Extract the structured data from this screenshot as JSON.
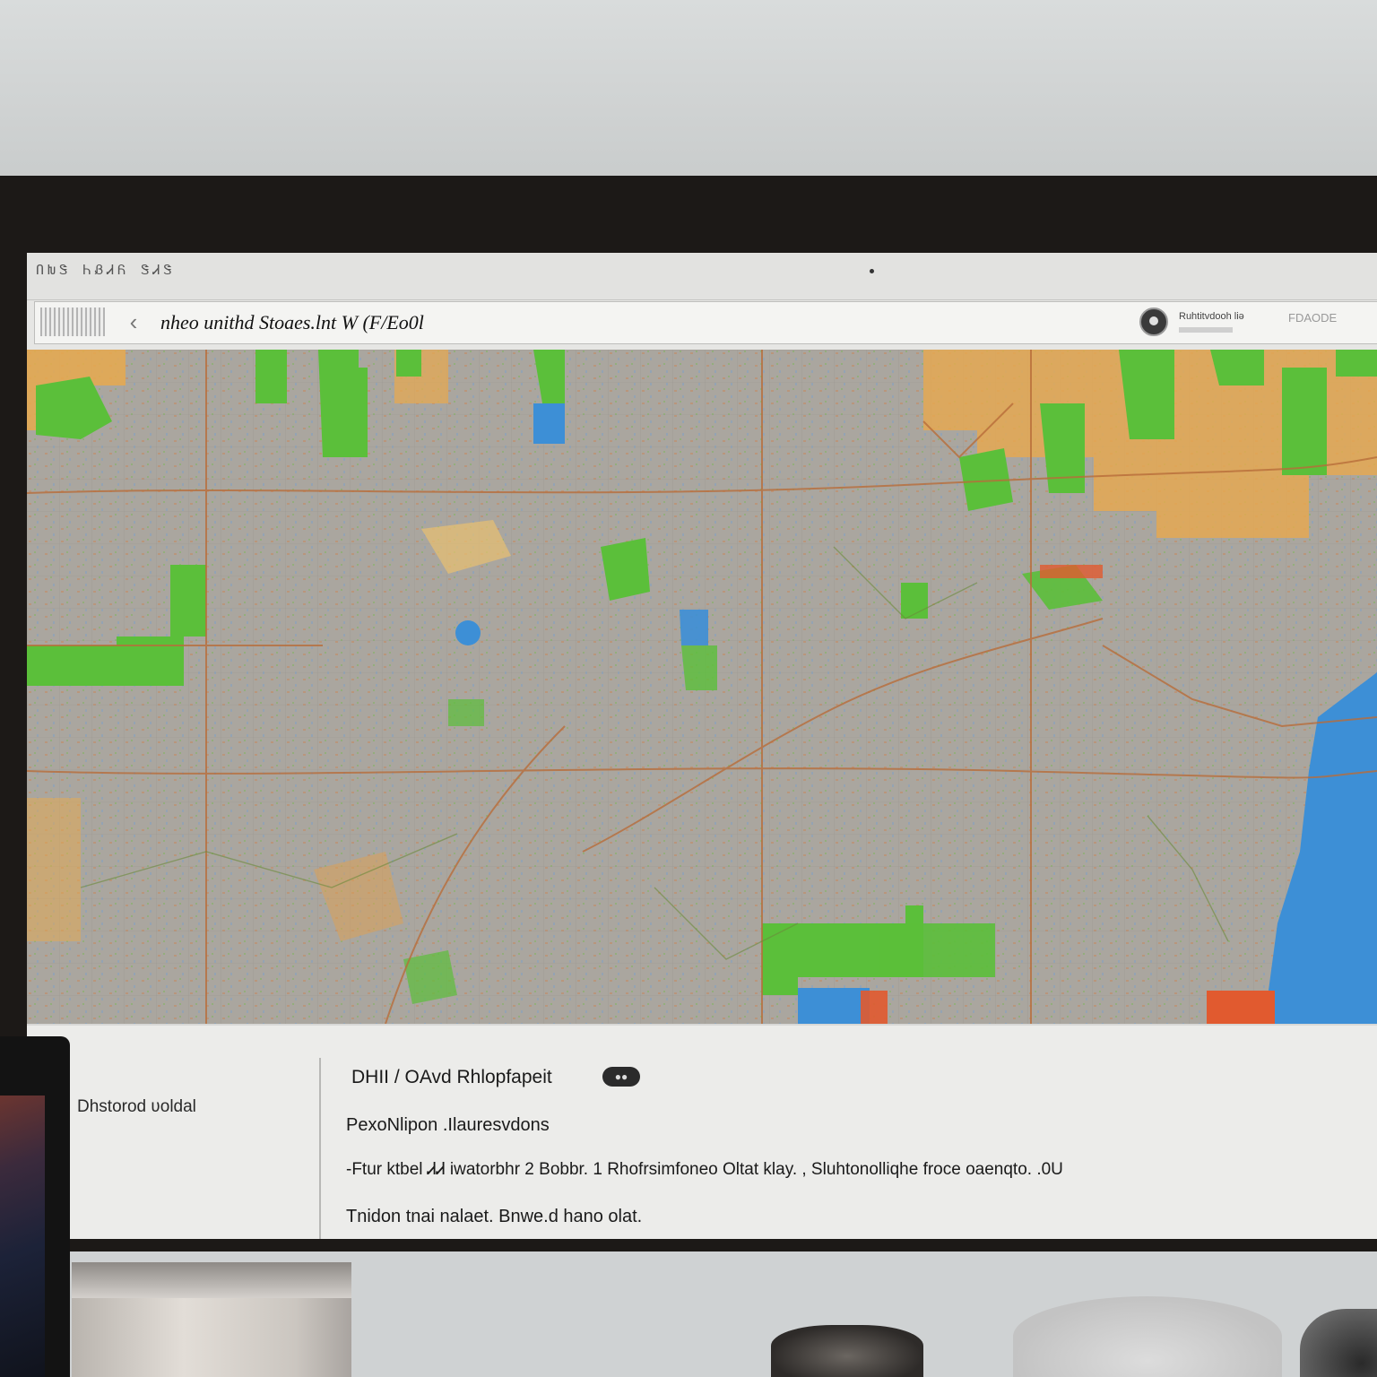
{
  "window": {
    "menu_text": "ՈԽᏕ ᏂᏰᏗᏲ ᏕᏗᏕ",
    "url_text": "nheo unithd Stoaes.lnt W (F/Eo0l",
    "ext_label": "Ruhtitvdooh liǝ",
    "ext_label2": "FDAODE"
  },
  "info_panel": {
    "side_label": "Dhstorod ʋoldal",
    "title": "DHII / OAvd Rhlopfapeit",
    "badge": "●●",
    "line1": "PexoNlipon .Ilauresvdons",
    "line2": "-Ftur ktbel ᏗᏗ  iwatorbhr 2  Bobbr.  1  Rhofrsimfoneo Oltat klay.  ,  Sluhtonolliqhe  froce  oaenqto.  .0U",
    "line3": "Tnidon  tnai nalaet. Bnwe.d  hano  olat."
  },
  "icons": [
    "back-icon",
    "profile-icon",
    "app-logo"
  ],
  "colors": {
    "map_base": "#a7a39c",
    "park_green": "#5bbf3a",
    "land_orange": "#e8a94e",
    "water_blue": "#3d8fd6",
    "highlight_red": "#e15a2f"
  }
}
